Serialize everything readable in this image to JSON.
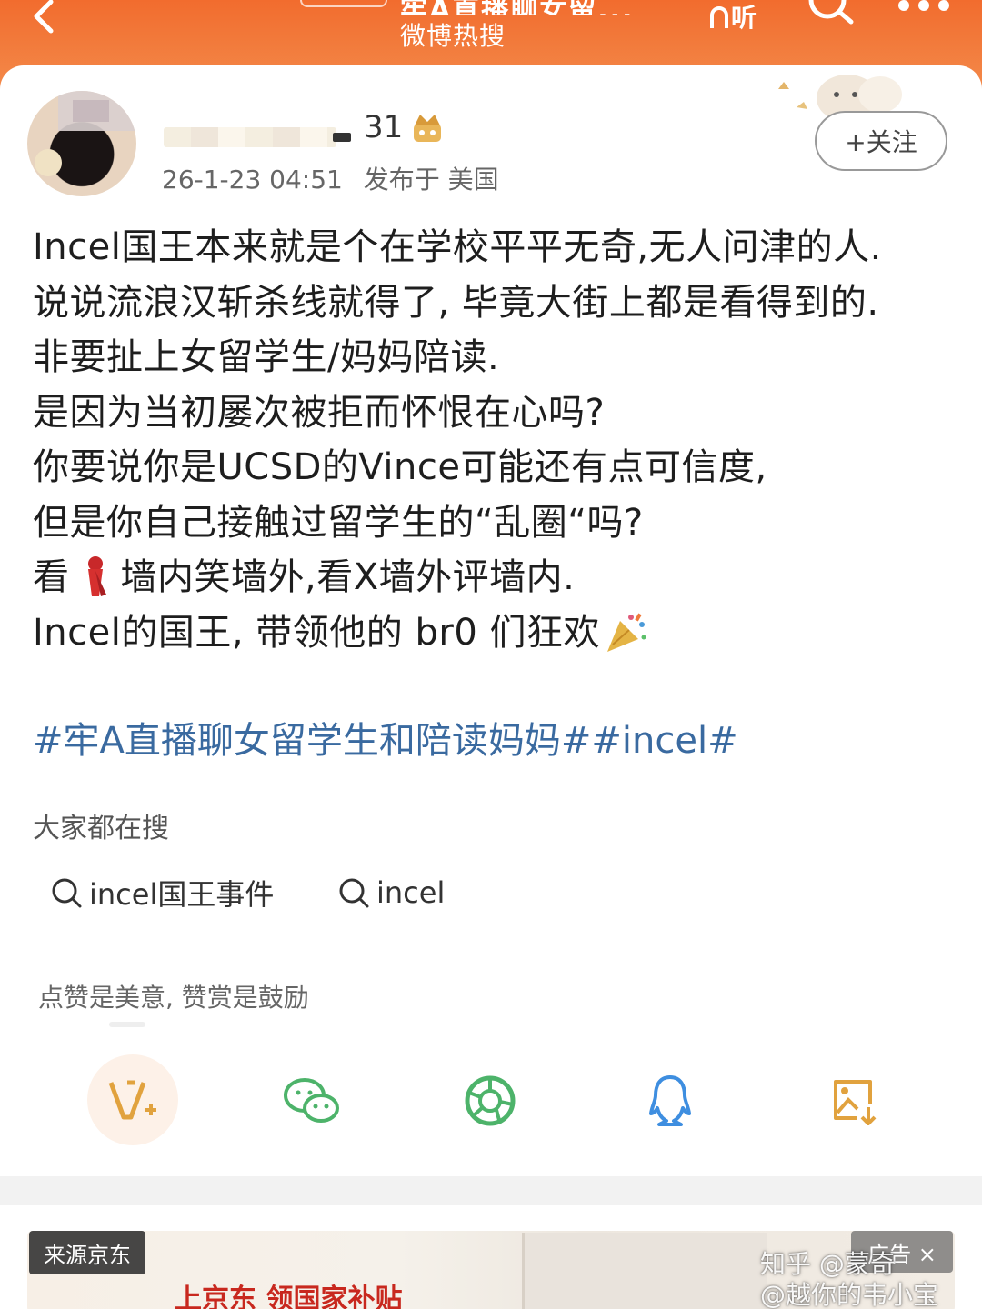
{
  "header": {
    "title": "牢A直播聊女留...",
    "subtitle": "微博热搜",
    "listen_label": "听",
    "back_icon": "chevron-left-icon",
    "search_icon": "search-icon",
    "more_icon": "more-dots-icon",
    "accent_color": "#f26c2e"
  },
  "post": {
    "user_level": "31",
    "timestamp": "26-1-23 04:51",
    "location": "发布于 美国",
    "follow_label": "+关注",
    "lines": [
      "Incel国王本来就是个在学校平平无奇,无人问津的人.",
      "说说流浪汉斩杀线就得了, 毕竟大街上都是看得到的.",
      "非要扯上女留学生/妈妈陪读.",
      "是因为当初屡次被拒而怀恨在心吗?",
      "你要说你是UCSD的Vince可能还有点可信度,",
      "但是你自己接触过留学生的“乱圈“吗?"
    ],
    "line7_before": "看",
    "line7_after": "墙内笑墙外,看X墙外评墙内.",
    "line8_text": "Incel的国王, 带领他的 br0 们狂欢",
    "hashtags": "#牢A直播聊女留学生和陪读妈妈##incel#",
    "hashtag_color": "#3a6aa0"
  },
  "search": {
    "heading": "大家都在搜",
    "chips": [
      "incel国王事件",
      "incel"
    ]
  },
  "reward": {
    "text": "点赞是美意, 赞赏是鼓励"
  },
  "share": {
    "icons": [
      "vip-reward-icon",
      "wechat-icon",
      "moments-icon",
      "qq-icon",
      "save-image-icon"
    ]
  },
  "ad": {
    "source": "来源京东",
    "headline": "上京东 领国家补贴",
    "close_label": "广告 ×"
  },
  "watermark": {
    "line1": "知乎 @蒙奇",
    "line2": "@越你的韦小宝"
  }
}
